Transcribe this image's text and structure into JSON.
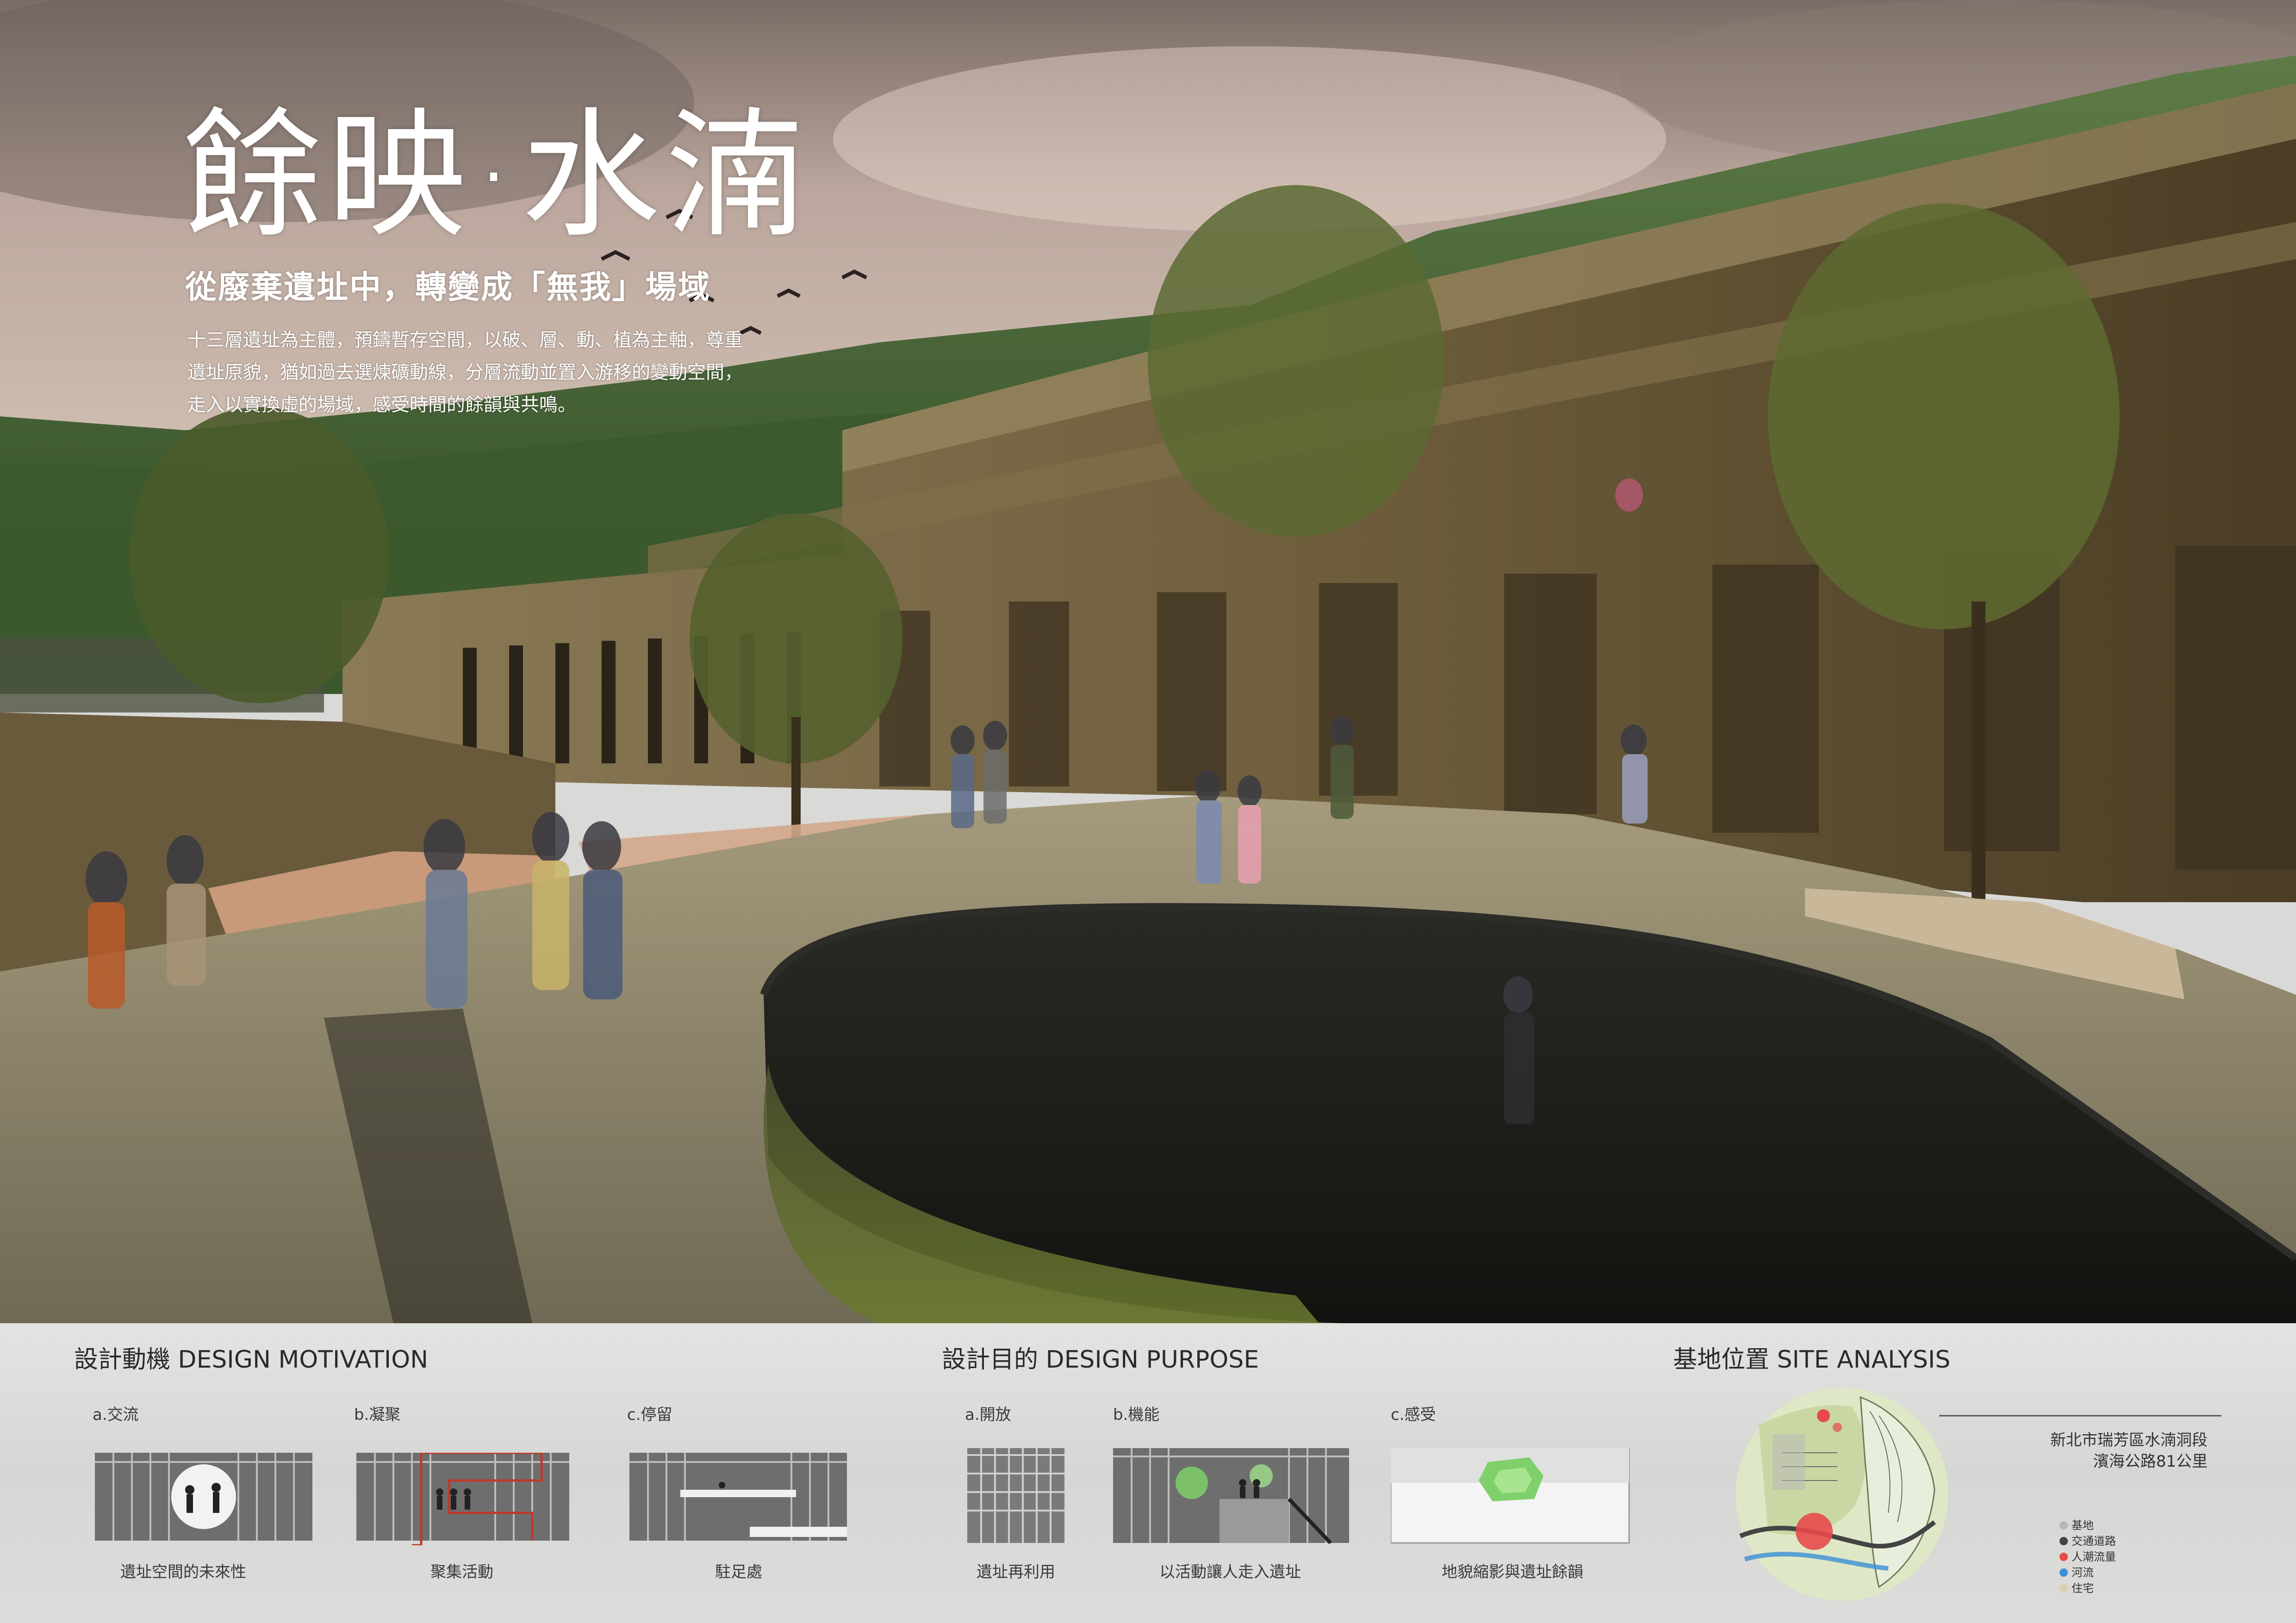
{
  "hero": {
    "title": "餘映·水湳",
    "subtitle": "從廢棄遺址中，轉變成「無我」場域",
    "description_lines": [
      "十三層遺址為主體，預鑄暫存空間，以破、層、動、植為主軸，尊重",
      "遺址原貌，猶如過去選煉礦動線，分層流動並置入游移的變動空間，",
      "走入以實換虛的場域，感受時間的餘韻與共鳴。"
    ]
  },
  "motivation": {
    "title": "設計動機 DESIGN MOTIVATION",
    "items": [
      {
        "label": "a.交流",
        "caption": "遺址空間的未來性"
      },
      {
        "label": "b.凝聚",
        "caption": "聚集活動"
      },
      {
        "label": "c.停留",
        "caption": "駐足處"
      }
    ]
  },
  "purpose": {
    "title": "設計目的 DESIGN PURPOSE",
    "items": [
      {
        "label": "a.開放",
        "caption": "遺址再利用"
      },
      {
        "label": "b.機能",
        "caption": "以活動讓人走入遺址"
      },
      {
        "label": "c.感受",
        "caption": "地貌縮影與遺址餘韻"
      }
    ]
  },
  "site": {
    "title": "基地位置 SITE ANALYSIS",
    "address_lines": [
      "新北市瑞芳區水湳洞段",
      "濱海公路81公里"
    ],
    "legend": [
      {
        "label": "基地",
        "color": "#b8b8b8"
      },
      {
        "label": "交通道路",
        "color": "#444444"
      },
      {
        "label": "人潮流量",
        "color": "#e84a4a"
      },
      {
        "label": "河流",
        "color": "#3a8fd6"
      },
      {
        "label": "住宅",
        "color": "#d9d2a8"
      }
    ]
  },
  "colors": {
    "accent_red": "#c0392b",
    "highlight_green": "#7fd06a",
    "diagram_gray": "#6e6e6e"
  }
}
